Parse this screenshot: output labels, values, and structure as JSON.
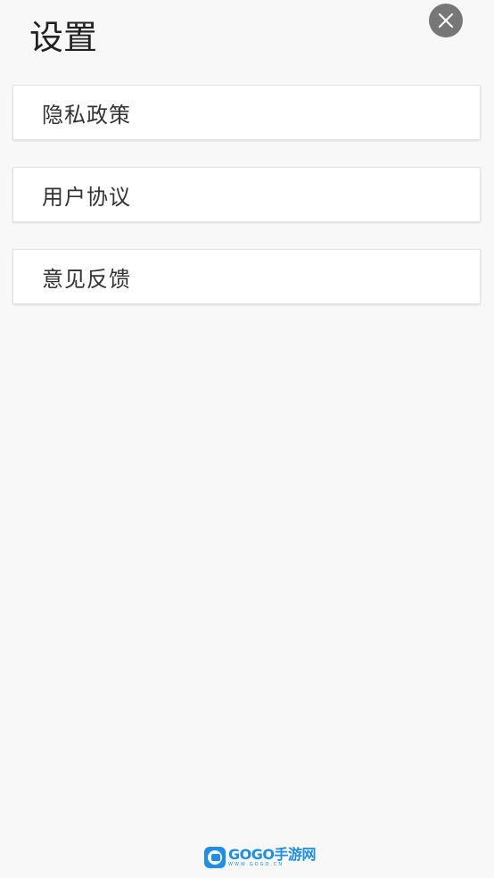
{
  "header": {
    "title": "设置"
  },
  "close_icon": "close-icon",
  "menu": {
    "items": [
      {
        "label": "隐私政策"
      },
      {
        "label": "用户协议"
      },
      {
        "label": "意见反馈"
      }
    ]
  },
  "footer": {
    "logo_main": "GOGO手游网",
    "logo_sub": "WWW.GOGO.CN"
  },
  "colors": {
    "background": "#f8f8f8",
    "close_button": "#777777",
    "logo_blue": "#1e8ee6"
  }
}
